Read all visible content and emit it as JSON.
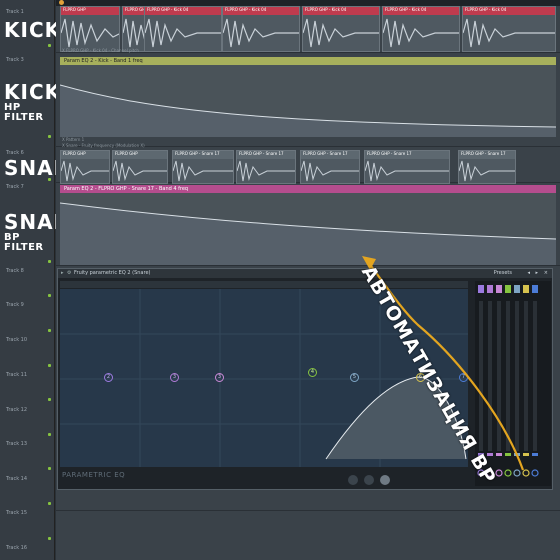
{
  "labels": {
    "kick": "KICK",
    "kick_hp_1": "KICK",
    "kick_hp_2": "HP FILTER",
    "snare": "SNARE",
    "snare_bp_1": "SNARE",
    "snare_bp_2": "BP FILTER"
  },
  "tracks": [
    "Track 1",
    "Track 3",
    "Track 6",
    "Track 7",
    "Track 8",
    "Track 9",
    "Track 10",
    "Track 11",
    "Track 12",
    "Track 13",
    "Track 14",
    "Track 15",
    "Track 16"
  ],
  "kick_clips": [
    "FLPRO GHP",
    "FLPRO GH",
    "FLPRO GHP - Kick 04",
    "FLPRO GHP - Kick 04",
    "FLPRO GHP - Kick 04",
    "FLPRO GHP - Kick 04",
    "FLPRO GHP - Kick 04"
  ],
  "snare_clips": [
    "FLPRO GHP",
    "FLPRO GHP",
    "FLPRO GHP - Snare 17",
    "FLPRO GHP - Snare 17",
    "FLPRO GHP - Snare 17",
    "FLPRO GHP - Snare 17",
    "FLPRO GHP - Snare 17"
  ],
  "auto": {
    "kick_param": "Param EQ 2 - Kick - Band 1 freq",
    "snare_param": "Param EQ 2 - FLPRO GHP - Snare 17 - Band 4 freq",
    "kick_sub": "X FLPRO GHP - Kick 04 - Channel pitch",
    "pattern": "X Pattern 1",
    "snare_sub": "X Snare - Fruity frequency (Modulation X)"
  },
  "eq": {
    "title": "Fruity parametric EQ 2 (Snare)",
    "presets": "Presets",
    "logo": "PARAMETRIC EQ",
    "nodes": [
      "2",
      "3",
      "3",
      "4",
      "5",
      "6",
      "7"
    ]
  },
  "annotation": "АВТОМАТИЗАЦИЯ BP",
  "colors": {
    "accent_red": "#bf3b4e",
    "kick_bar": "#a7b05c",
    "snare_bar": "#b54d8e",
    "arrow": "#e3a520"
  }
}
